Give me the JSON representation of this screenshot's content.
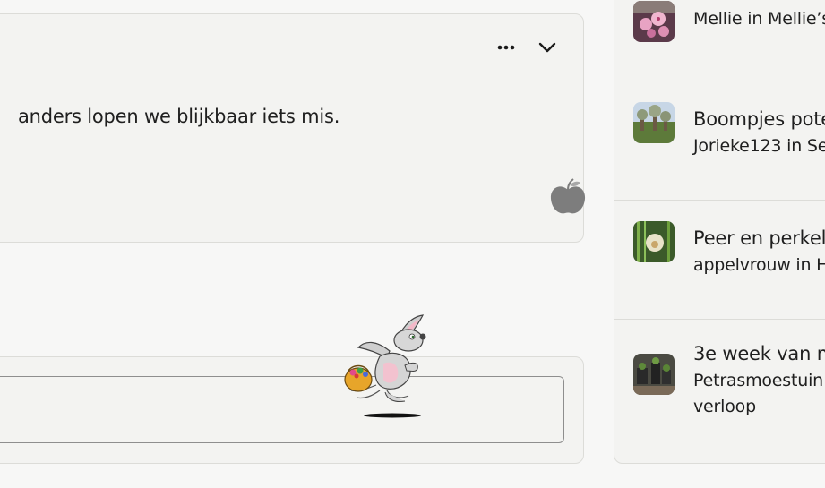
{
  "post": {
    "text": "anders lopen we blijkbaar iets mis.",
    "more_icon": "more-horizontal-icon",
    "collapse_icon": "chevron-down-icon",
    "like_icon": "apple-icon"
  },
  "reply": {
    "placeholder": ""
  },
  "decoration": {
    "image": "easter-bunny-with-basket"
  },
  "sidebar": {
    "items": [
      {
        "title": "",
        "subtitle": "Mellie in Mellie’s",
        "subtitle2": "",
        "thumb": "pink-blossom"
      },
      {
        "title": "Boompjes pote",
        "subtitle": "Jorieke123 in Sei",
        "subtitle2": "",
        "thumb": "orchard-trees"
      },
      {
        "title": "Peer en perkel",
        "subtitle": "appelvrouw in H",
        "subtitle2": "",
        "thumb": "dandelion-seedhead"
      },
      {
        "title": "3e week van m",
        "subtitle": "Petrasmoestuin",
        "subtitle2": "verloop",
        "thumb": "garden-pots"
      }
    ]
  },
  "colors": {
    "background": "#f7f7f6",
    "card": "#f3f3f1",
    "border": "#dcdcd8",
    "apple": "#7d7d7d"
  }
}
